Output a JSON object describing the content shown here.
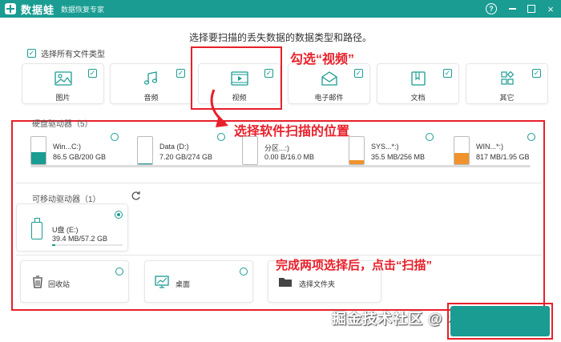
{
  "app": {
    "name": "数据蛙",
    "subtitle": "数据恢复专家"
  },
  "window_controls": {
    "help": "?",
    "close": "×"
  },
  "heading": "选择要扫描的丢失数据的数据类型和路径。",
  "select_all": {
    "label": "选择所有文件类型",
    "checked": true
  },
  "file_types": [
    {
      "label": "图片",
      "checked": true,
      "icon": "image-icon"
    },
    {
      "label": "音频",
      "checked": true,
      "icon": "music-icon"
    },
    {
      "label": "视频",
      "checked": true,
      "icon": "video-icon"
    },
    {
      "label": "电子邮件",
      "checked": true,
      "icon": "email-icon"
    },
    {
      "label": "文档",
      "checked": true,
      "icon": "document-icon"
    },
    {
      "label": "其它",
      "checked": true,
      "icon": "other-icon"
    }
  ],
  "hard_drives": {
    "label": "硬盘驱动器（5）",
    "items": [
      {
        "name": "Win...C:)",
        "size": "86.5 GB/200 GB",
        "fill_fraction": 0.43,
        "fill_color": "#1a9c92"
      },
      {
        "name": "Data (D:)",
        "size": "7.20 GB/274 GB",
        "fill_fraction": 0.03,
        "fill_color": "#1a9c92"
      },
      {
        "name": "分区...:)",
        "size": "0.00  B/16.0 MB",
        "fill_fraction": 0.0,
        "fill_color": "#f0932b"
      },
      {
        "name": "SYS...*:)",
        "size": "35.5 MB/256 MB",
        "fill_fraction": 0.14,
        "fill_color": "#f0932b"
      },
      {
        "name": "WIN...*:)",
        "size": "817 MB/1.95 GB",
        "fill_fraction": 0.42,
        "fill_color": "#f0932b"
      }
    ]
  },
  "removable_drives": {
    "label": "可移动驱动器（1）",
    "items": [
      {
        "name": "U盘 (E:)",
        "size": "39.4 MB/57.2 GB",
        "selected": true,
        "fill_fraction": 0.05
      }
    ]
  },
  "locations": [
    {
      "label": "回收站",
      "icon": "trash-icon"
    },
    {
      "label": "桌面",
      "icon": "desktop-icon"
    },
    {
      "label": "选择文件夹",
      "icon": "folder-icon"
    }
  ],
  "annotations": {
    "check_video": "勾选“视频”",
    "select_location": "选择软件扫描的位置",
    "click_scan": "完成两项选择后，点击“扫描”"
  },
  "watermark": "掘金技术社区 @ 小明助手",
  "colors": {
    "accent": "#1a9c92",
    "annotation": "#e8202a",
    "orange": "#f0932b"
  }
}
